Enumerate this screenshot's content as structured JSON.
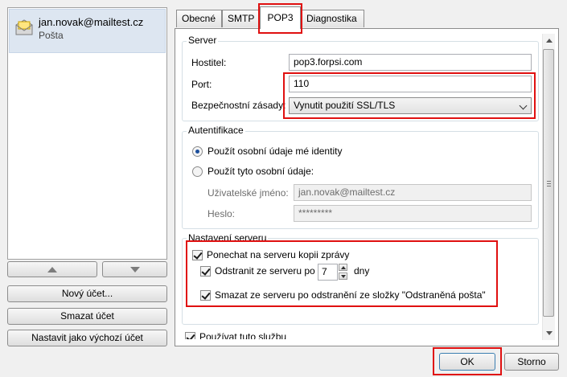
{
  "account": {
    "email": "jan.novak@mailtest.cz",
    "type": "Pošta"
  },
  "left_buttons": {
    "new_account": "Nový účet...",
    "delete_account": "Smazat účet",
    "set_default": "Nastavit jako výchozí účet"
  },
  "tabs": [
    {
      "label": "Obecné",
      "active": false
    },
    {
      "label": "SMTP",
      "active": false
    },
    {
      "label": "POP3",
      "active": true
    },
    {
      "label": "Diagnostika",
      "active": false
    }
  ],
  "server": {
    "title": "Server",
    "host_label": "Hostitel:",
    "host_value": "pop3.forpsi.com",
    "port_label": "Port:",
    "port_value": "110",
    "security_label": "Bezpečnostní zásady:",
    "security_value": "Vynutit použití SSL/TLS"
  },
  "auth": {
    "title": "Autentifikace",
    "option_identity": "Použít osobní údaje mé identity",
    "option_custom": "Použít tyto osobní údaje:",
    "username_label": "Uživatelské jméno:",
    "username_value": "jan.novak@mailtest.cz",
    "password_label": "Heslo:",
    "password_value": "*********"
  },
  "server_settings": {
    "title": "Nastavení serveru",
    "keep_copy": "Ponechat na serveru kopii zprávy",
    "delete_after_prefix": "Odstranit ze serveru po",
    "delete_after_days": "7",
    "delete_after_suffix": "dny",
    "delete_on_trash": "Smazat ze serveru po odstranění ze složky \"Odstraněná pošta\""
  },
  "use_service": "Používat tuto službu",
  "footer": {
    "ok": "OK",
    "cancel": "Storno"
  },
  "colors": {
    "highlight": "#e01010",
    "selected_account_bg": "#dde6f1"
  }
}
